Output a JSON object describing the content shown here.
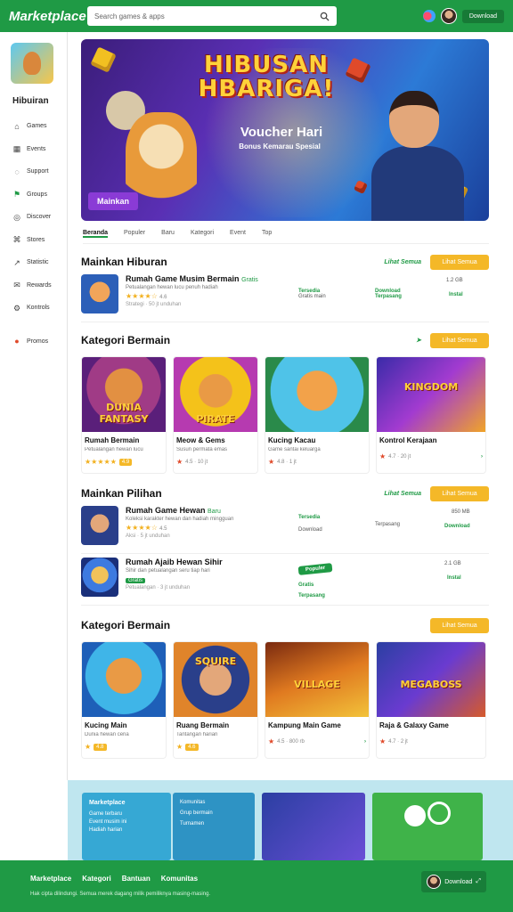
{
  "header": {
    "logo": "Marketplace",
    "search_placeholder": "Search games & apps",
    "button": "Download"
  },
  "sidebar": {
    "title": "Hibuiran",
    "items": [
      {
        "label": "Games",
        "icon": "gamepad-icon"
      },
      {
        "label": "Events",
        "icon": "calendar-icon"
      },
      {
        "label": "Support",
        "icon": "chat-icon"
      },
      {
        "label": "Groups",
        "icon": "group-icon"
      },
      {
        "label": "Discover",
        "icon": "compass-icon"
      },
      {
        "label": "Stores",
        "icon": "store-icon"
      },
      {
        "label": "Statistic",
        "icon": "chart-icon"
      },
      {
        "label": "Rewards",
        "icon": "gift-icon"
      },
      {
        "label": "Kontrols",
        "icon": "controller-icon"
      },
      {
        "label": "Promos",
        "icon": "promo-icon"
      }
    ]
  },
  "banner": {
    "title": "HIBUSAN HBARIGA!",
    "subtitle": "Voucher Hari",
    "tagline": "Bonus Kemarau Spesial",
    "cta": "Mainkan"
  },
  "tabs": [
    "Beranda",
    "Populer",
    "Baru",
    "Kategori",
    "Event",
    "Top"
  ],
  "sections": {
    "featured": {
      "title": "Mainkan Hiburan",
      "link": "Lihat Semua",
      "button": "Lihat Semua",
      "rows": [
        {
          "title": "Rumah Game Musim Bermain",
          "tag": "Gratis",
          "desc": "Petualangan hewan lucu penuh hadiah",
          "rating": "★★★★☆",
          "rating_count": "4.6",
          "meta": "Strategi · 50 jt unduhan",
          "col1_top": "Tersedia",
          "col1_bottom": "Gratis main",
          "col2_top": "Download",
          "col2_bottom": "Terpasang",
          "col3_top": "1.2 GB",
          "col3_bottom": "Instal"
        }
      ]
    },
    "popular": {
      "title": "Kategori Bermain",
      "button": "Lihat Semua",
      "cards": [
        {
          "name": "Rumah Bermain",
          "desc": "Petualangan hewan lucu",
          "stars": "★★★★★",
          "badge": "4.9",
          "meta": "",
          "image_text": "DUNIA FANTASY"
        },
        {
          "name": "Meow & Gems",
          "desc": "Susun permata emas",
          "stars": "★",
          "badge": "",
          "meta": "4.5 · 10 jt",
          "image_text": "PIRATE"
        },
        {
          "name": "Kucing Kacau",
          "desc": "Game santai keluarga",
          "stars": "★",
          "badge": "",
          "meta": "4.8 · 1 jt",
          "image_text": ""
        },
        {
          "name": "Kontrol Kerajaan",
          "desc": "",
          "stars": "★",
          "badge": "",
          "meta": "4.7 · 20 jt",
          "image_text": "KINGDOM"
        }
      ]
    },
    "ranked": {
      "title": "Mainkan Pilihan",
      "link": "Lihat Semua",
      "button": "Lihat Semua",
      "rows": [
        {
          "title": "Rumah Game Hewan",
          "tag": "Baru",
          "desc": "Koleksi karakter hewan dan hadiah mingguan",
          "rating": "★★★★☆",
          "rating_count": "4.5",
          "meta": "Aksi · 5 jt unduhan",
          "col1_top": "Tersedia",
          "col1_bottom": "Download",
          "col2_top": "",
          "col2_bottom": "Terpasang",
          "col3_top": "850 MB",
          "col3_bottom": "Download"
        },
        {
          "title": "Rumah Ajaib Hewan Sihir",
          "tag": "",
          "desc": "Sihir dan petualangan seru tiap hari",
          "rating": "",
          "rating_count": "Gratis",
          "meta": "Petualangan · 3 jt unduhan",
          "col1_top": "Gratis",
          "col1_bottom": "Terpasang",
          "col2_top": "Populer",
          "col2_bottom": "",
          "col3_top": "2.1 GB",
          "col3_bottom": "Instal"
        }
      ]
    },
    "new": {
      "title": "Kategori Bermain",
      "button": "Lihat Semua",
      "cards": [
        {
          "name": "Kucing Main",
          "desc": "Dunia hewan ceria",
          "stars": "★",
          "badge": "4.8",
          "meta": "",
          "image_text": ""
        },
        {
          "name": "Ruang Bermain",
          "desc": "Tantangan harian",
          "stars": "★",
          "badge": "4.6",
          "meta": "",
          "image_text": "SQUIRE"
        },
        {
          "name": "Kampung Main Game",
          "desc": "",
          "stars": "★",
          "badge": "",
          "meta": "4.5 · 800 rb",
          "image_text": "VILLAGE"
        },
        {
          "name": "Raja & Galaxy Game",
          "desc": "",
          "stars": "★",
          "badge": "",
          "meta": "4.7 · 2 jt",
          "image_text": "MEGABOSS"
        }
      ]
    }
  },
  "promo": {
    "p1_title": "Marketplace",
    "p1_lines": [
      "Game terbaru",
      "Event musim ini",
      "Hadiah harian"
    ],
    "p2_lines": [
      "Komunitas",
      "Grup bermain",
      "Turnamen"
    ]
  },
  "footer": {
    "links": [
      "Marketplace",
      "Kategori",
      "Bantuan",
      "Komunitas"
    ],
    "small": "Hak cipta dilindungi. Semua merek dagang milik pemiliknya masing-masing.",
    "right_label": "Download"
  },
  "colors": {
    "brand": "#1f9a45",
    "accent": "#f4b828"
  }
}
